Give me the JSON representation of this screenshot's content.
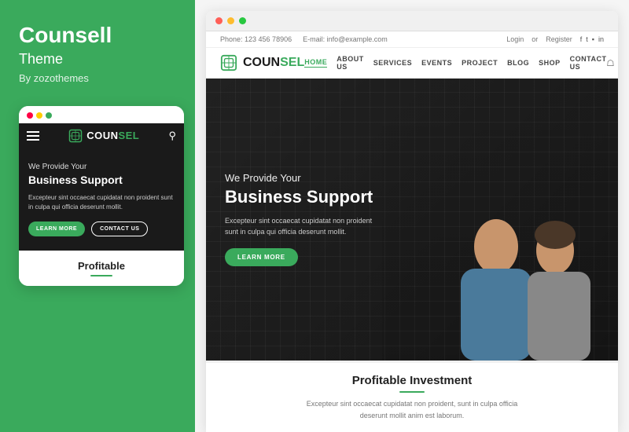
{
  "left": {
    "title": "Counsell",
    "subtitle": "Theme",
    "author": "By zozothemes",
    "mobile": {
      "dots": [
        "red",
        "yellow",
        "green"
      ],
      "nav": {
        "logo_text_first": "COUN",
        "logo_text_second": "SEL"
      },
      "hero": {
        "subtitle": "We Provide Your",
        "title": "Business Support",
        "body": "Excepteur sint occaecat cupidatat non proident sunt in culpa qui officia deserunt mollit.",
        "btn_learn": "LEARN MORE",
        "btn_contact": "CONTACT US"
      },
      "section_title": "Profitable"
    }
  },
  "right": {
    "browser": {
      "topbar": {
        "phone": "Phone: 123 456 78906",
        "email": "E-mail: info@example.com",
        "login": "Login",
        "or": "or",
        "register": "Register",
        "socials": [
          "f",
          "t",
          "in",
          "in"
        ]
      },
      "navbar": {
        "logo_first": "COUN",
        "logo_second": "SEL",
        "links": [
          "HOME",
          "ABOUT US",
          "SERVICES",
          "EVENTS",
          "PROJECT",
          "BLOG",
          "SHOP",
          "CONTACT US"
        ],
        "active_link": "HOME"
      },
      "hero": {
        "subtitle": "We Provide Your",
        "title": "Business Support",
        "body": "Excepteur sint occaecat cupidatat non proident sunt in\nculpa qui officia deserunt mollit.",
        "btn_learn": "LEARN MORE"
      },
      "below": {
        "title": "Profitable Investment",
        "body": "Excepteur sint occaecat cupidatat non proident, sunt in culpa officia deserunt mollit anim est laborum."
      }
    }
  },
  "colors": {
    "green": "#3aaa5c",
    "dark": "#1a1a1a",
    "white": "#ffffff"
  }
}
